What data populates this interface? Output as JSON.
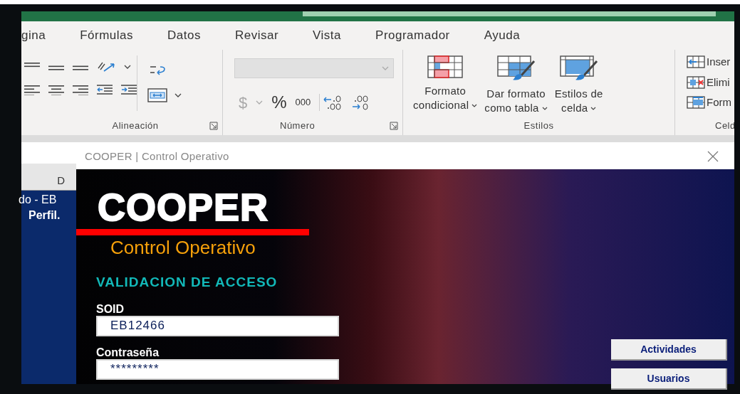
{
  "ribbon": {
    "tabs": [
      "gina",
      "Fórmulas",
      "Datos",
      "Revisar",
      "Vista",
      "Programador",
      "Ayuda"
    ],
    "alignment": {
      "label": "Alineación"
    },
    "number": {
      "label": "Número",
      "symbols": [
        "$",
        "%",
        "000"
      ]
    },
    "styles": {
      "label": "Estilos",
      "buttons": [
        {
          "kind": "conditional",
          "lines": [
            "Formato",
            "condicional"
          ]
        },
        {
          "kind": "table",
          "lines": [
            "Dar formato",
            "como tabla"
          ]
        },
        {
          "kind": "cell",
          "lines": [
            "Estilos de",
            "celda"
          ]
        }
      ]
    },
    "cells": {
      "label": "Celd",
      "items": [
        {
          "kind": "insert",
          "label": "Inser"
        },
        {
          "kind": "delete",
          "label": "Elimi"
        },
        {
          "kind": "format",
          "label": "Form"
        }
      ]
    }
  },
  "sheet": {
    "column_header": "D",
    "cells": [
      "do - EB",
      "Perfil."
    ]
  },
  "dialog": {
    "title": "COOPER | Control Operativo",
    "brand": "COOPER",
    "subtitle": "Control Operativo",
    "heading": "VALIDACION DE ACCESO",
    "fields": [
      {
        "label": "SOID",
        "value": "EB12466"
      },
      {
        "label": "Contraseña",
        "value": "*********"
      }
    ],
    "buttons": [
      "Actividades",
      "Usuarios"
    ]
  }
}
